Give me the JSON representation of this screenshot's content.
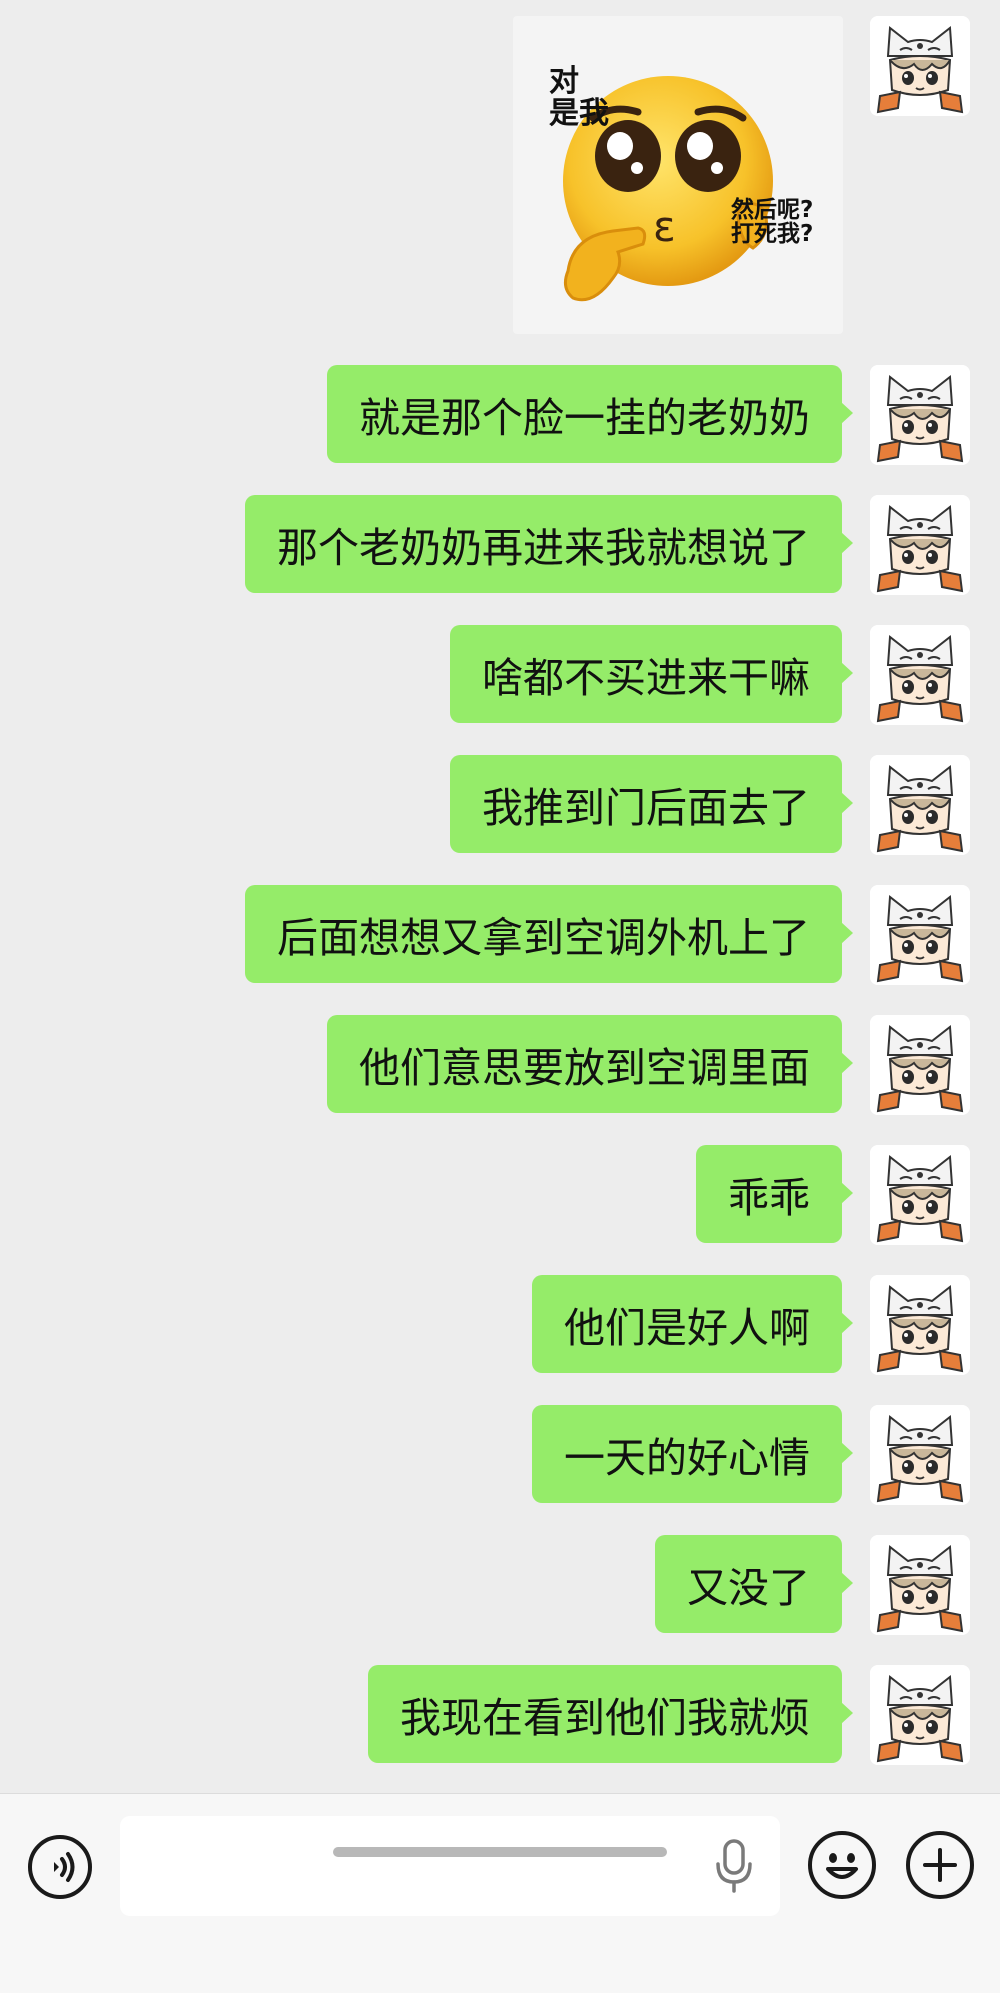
{
  "sticker": {
    "text_top": "对\n是我",
    "text_right": "然后呢?\n打死我?"
  },
  "messages": [
    {
      "text": "就是那个脸一挂的老奶奶"
    },
    {
      "text": "那个老奶奶再进来我就想说了"
    },
    {
      "text": "啥都不买进来干嘛"
    },
    {
      "text": "我推到门后面去了"
    },
    {
      "text": "后面想想又拿到空调外机上了"
    },
    {
      "text": "他们意思要放到空调里面"
    },
    {
      "text": "乖乖"
    },
    {
      "text": "他们是好人啊"
    },
    {
      "text": "一天的好心情"
    },
    {
      "text": "又没了"
    },
    {
      "text": "我现在看到他们我就烦"
    }
  ],
  "input": {
    "value": ""
  },
  "icons": {
    "voice": "voice-toggle-icon",
    "mic": "microphone-icon",
    "emoji": "emoji-icon",
    "plus": "plus-icon"
  },
  "colors": {
    "background": "#ededed",
    "bubble": "#95ec69",
    "input_bar": "#f7f7f7"
  }
}
